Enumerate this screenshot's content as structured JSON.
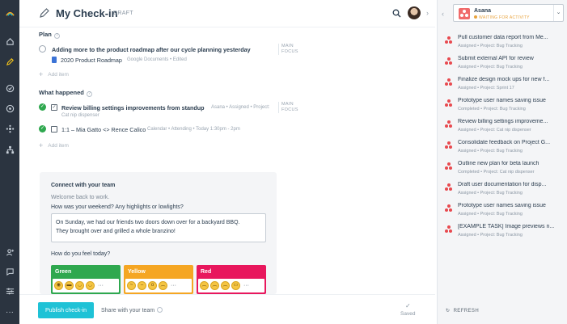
{
  "header": {
    "title": "My Check-in",
    "status": "DRAFT"
  },
  "plan": {
    "title": "Plan",
    "items": [
      {
        "text": "Adding more to the product roadmap after our cycle planning yesterday",
        "doc": "2020 Product Roadmap",
        "doc_meta": "Google Documents • Edited",
        "tag": [
          "MAIN",
          "FOCUS"
        ]
      }
    ],
    "add_label": "Add item"
  },
  "happened": {
    "title": "What happened",
    "items": [
      {
        "text": "Review billing settings improvements from standup",
        "meta": "Asana • Assigned • Project:",
        "meta2": "Cat nip dispenser",
        "tag": [
          "MAIN",
          "FOCUS"
        ]
      },
      {
        "text": "1:1 – Mia Gatto <> Rence Calico",
        "meta": "Calendar • Attending • Today 1:30pm - 2pm"
      }
    ],
    "add_label": "Add item"
  },
  "connect": {
    "title": "Connect with your team",
    "welcome": "Welcome back to work.",
    "question1": "How was your weekend? Any highlights or lowlights?",
    "answer_line1": "On Sunday, we had our friends two doors down over for a backyard BBQ.",
    "answer_line2": "They brought over and grilled a whole branzino!",
    "question2": "How do you feel today?",
    "moods": [
      {
        "label": "Green",
        "color": "#2fa84f"
      },
      {
        "label": "Yellow",
        "color": "#f5a623"
      },
      {
        "label": "Red",
        "color": "#e8175d"
      }
    ]
  },
  "footer": {
    "publish": "Publish check-in",
    "share": "Share with your team",
    "saved": "Saved"
  },
  "panel": {
    "app_name": "Asana",
    "app_status": "WAITING FOR ACTIVITY",
    "tasks": [
      {
        "name": "Pull customer data report from Me...",
        "meta": "Assigned • Project: Bug Tracking"
      },
      {
        "name": "Submit external API for review",
        "meta": "Assigned • Project: Bug Tracking"
      },
      {
        "name": "Finalize design mock ups for new f...",
        "meta": "Assigned • Project: Sprint 17"
      },
      {
        "name": "Prototype user names saving issue",
        "meta": "Completed • Project: Bug Tracking"
      },
      {
        "name": "Review billing settings improveme...",
        "meta": "Assigned • Project: Cat nip dispenser"
      },
      {
        "name": "Consolidate feedback on Project G...",
        "meta": "Assigned • Project: Bug Tracking"
      },
      {
        "name": "Outline new plan for beta launch",
        "meta": "Completed • Project: Cat nip dispenser"
      },
      {
        "name": "Draft user documentation for disp...",
        "meta": "Assigned • Project: Bug Tracking"
      },
      {
        "name": "Prototype user names saving issue",
        "meta": "Assigned • Project: Bug Tracking"
      },
      {
        "name": "[EXAMPLE TASK] Image previews n...",
        "meta": "Assigned • Project: Bug Tracking"
      }
    ],
    "refresh": "REFRESH"
  }
}
